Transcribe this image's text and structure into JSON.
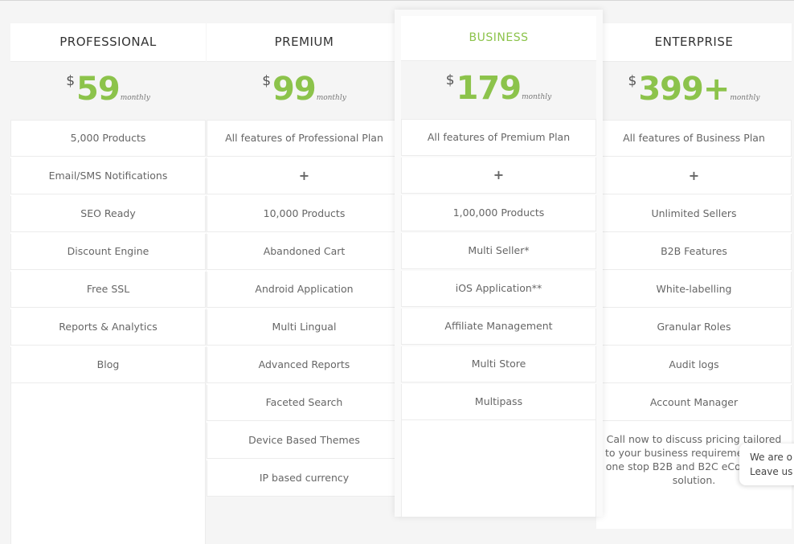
{
  "accent_color": "#8cc34b",
  "plans": [
    {
      "name": "PROFESSIONAL",
      "currency": "$",
      "amount": "59",
      "period": "monthly",
      "features": [
        "5,000 Products",
        "Email/SMS Notifications",
        "SEO Ready",
        "Discount Engine",
        "Free SSL",
        "Reports & Analytics",
        "Blog"
      ]
    },
    {
      "name": "PREMIUM",
      "currency": "$",
      "amount": "99",
      "period": "monthly",
      "features": [
        "All features of Professional Plan",
        "+",
        "10,000 Products",
        "Abandoned Cart",
        "Android Application",
        "Multi Lingual",
        "Advanced Reports",
        "Faceted Search",
        "Device Based Themes",
        "IP based currency"
      ]
    },
    {
      "name": "BUSINESS",
      "featured": true,
      "currency": "$",
      "amount": "179",
      "period": "monthly",
      "features": [
        "All features of Premium Plan",
        "+",
        "1,00,000 Products",
        "Multi Seller*",
        "iOS Application**",
        "Affiliate Management",
        "Multi Store",
        "Multipass"
      ]
    },
    {
      "name": "ENTERPRISE",
      "currency": "$",
      "amount": "399+",
      "period": "monthly",
      "features": [
        "All features of Business Plan",
        "+",
        "Unlimited Sellers",
        "B2B Features",
        "White-labelling",
        "Granular Roles",
        "Audit logs",
        "Account Manager"
      ],
      "cta_text": "Call now to discuss pricing tailored to your business requirements. Get one stop B2B and B2C eCommerce solution."
    }
  ],
  "chat_popup": {
    "line1": "We are o",
    "line2": "Leave us a"
  }
}
